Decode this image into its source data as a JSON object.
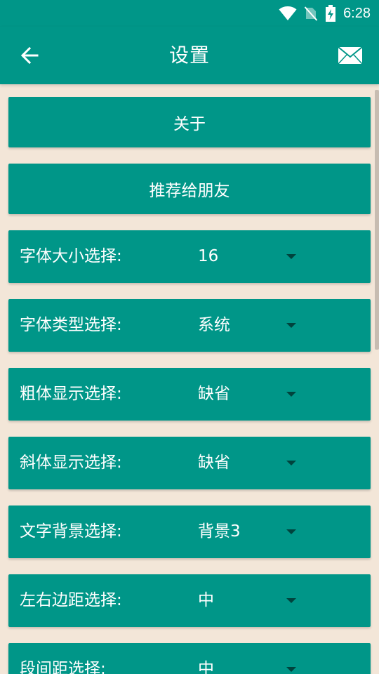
{
  "status_bar": {
    "time": "6:28",
    "icons": [
      "wifi-icon",
      "no-signal-icon",
      "battery-charging-icon"
    ]
  },
  "app_bar": {
    "title": "设置",
    "back_icon": "arrow-back-icon",
    "action_icon": "mail-icon"
  },
  "buttons": {
    "about": "关于",
    "recommend": "推荐给朋友"
  },
  "settings": [
    {
      "label": "字体大小选择:",
      "value": "16"
    },
    {
      "label": "字体类型选择:",
      "value": "系统"
    },
    {
      "label": "粗体显示选择:",
      "value": "缺省"
    },
    {
      "label": "斜体显示选择:",
      "value": "缺省"
    },
    {
      "label": "文字背景选择:",
      "value": "背景3"
    },
    {
      "label": "左右边距选择:",
      "value": "中"
    },
    {
      "label": "段间距选择:",
      "value": "中"
    }
  ],
  "colors": {
    "primary": "#009688",
    "background": "#f3e6d8",
    "text": "#ffffff"
  }
}
